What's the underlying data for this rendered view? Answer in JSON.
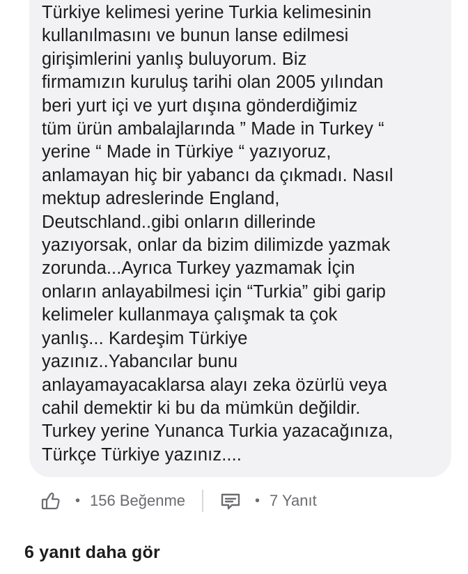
{
  "comment": {
    "lines": [
      "Türkiye kelimesi yerine Turkia kelimesinin",
      "kullanılmasını ve bunun lanse edilmesi",
      "girişimlerini yanlış buluyorum. Biz",
      "firmamızın kuruluş tarihi olan 2005 yılından",
      "beri yurt içi ve yurt dışına gönderdiğimiz",
      "tüm ürün ambalajlarında ” Made in Turkey “",
      "yerine “ Made in Türkiye “ yazıyoruz,",
      "anlamayan hiç bir yabancı da çıkmadı. Nasıl",
      "mektup adreslerinde England,",
      "Deutschland..gibi onların dillerinde",
      "yazıyorsak, onlar da bizim dilimizde yazmak",
      "zorunda...Ayrıca Turkey yazmamak İçin",
      "onların anlayabilmesi için “Turkia” gibi garip",
      "kelimeler kullanmaya çalışmak ta çok",
      "yanlış... Kardeşim Türkiye",
      "yazınız..Yabancılar bunu",
      "anlayamayacaklarsa alayı zeka özürlü veya",
      "cahil demektir ki bu da mümkün değildir.",
      "Turkey yerine Yunanca Turkia yazacağınıza,",
      "Türkçe Türkiye yazınız...."
    ]
  },
  "actions": {
    "like_icon": "thumbs-up-icon",
    "like_separator": "•",
    "like_count_label": "156 Beğenme",
    "reply_icon": "comment-icon",
    "reply_separator": "•",
    "reply_count_label": "7 Yanıt"
  },
  "more_replies_label": "6 yanıt daha gör",
  "colors": {
    "bubble_background": "#f2f2f4",
    "text": "#1c1c1e",
    "muted": "#6b6b70"
  }
}
